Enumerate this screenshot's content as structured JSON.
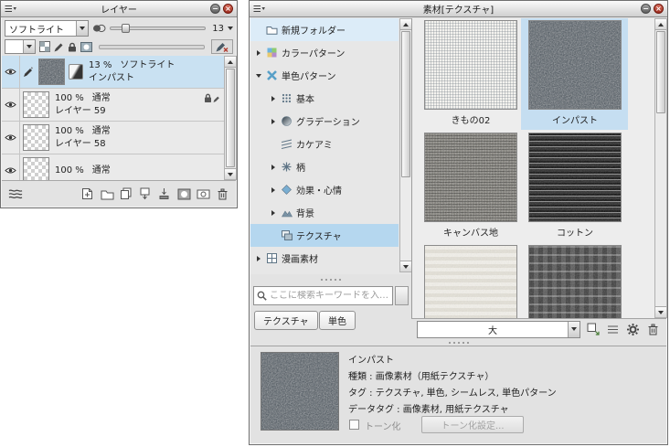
{
  "layers": {
    "title": "レイヤー",
    "blend_mode": "ソフトライト",
    "opacity_value": "13",
    "rows": [
      {
        "opacity": "13 %",
        "mode": "ソフトライト",
        "name": "インパスト"
      },
      {
        "opacity": "100 %",
        "mode": "通常",
        "name": "レイヤー 59"
      },
      {
        "opacity": "100 %",
        "mode": "通常",
        "name": "レイヤー 58"
      },
      {
        "opacity": "100 %",
        "mode": "通常",
        "name": ""
      }
    ]
  },
  "material": {
    "title": "素材[テクスチャ]",
    "tree": [
      {
        "label": "新規フォルダー"
      },
      {
        "label": "カラーパターン"
      },
      {
        "label": "単色パターン"
      },
      {
        "label": "基本"
      },
      {
        "label": "グラデーション"
      },
      {
        "label": "カケアミ"
      },
      {
        "label": "柄"
      },
      {
        "label": "効果・心情"
      },
      {
        "label": "背景"
      },
      {
        "label": "テクスチャ"
      },
      {
        "label": "漫画素材"
      }
    ],
    "search_placeholder": "ここに検索キーワードを入…",
    "tags": [
      {
        "label": "テクスチャ"
      },
      {
        "label": "単色"
      }
    ],
    "items": [
      {
        "label": "きもの02"
      },
      {
        "label": "インパスト"
      },
      {
        "label": "キャンバス地"
      },
      {
        "label": "コットン"
      }
    ],
    "size_value": "大",
    "detail": {
      "name": "インパスト",
      "type": "種類 : 画像素材（用紙テクスチャ）",
      "tags": "タグ : テクスチャ, 単色, シームレス, 単色パターン",
      "data_tags": "データタグ : 画像素材, 用紙テクスチャ",
      "tone_label": "トーン化",
      "tone_button_label": "トーン化設定..."
    }
  },
  "colors": {
    "selection_blue": "#c5def1",
    "highlight_blue": "#dcecf8",
    "close_red": "#9e2d1f"
  }
}
